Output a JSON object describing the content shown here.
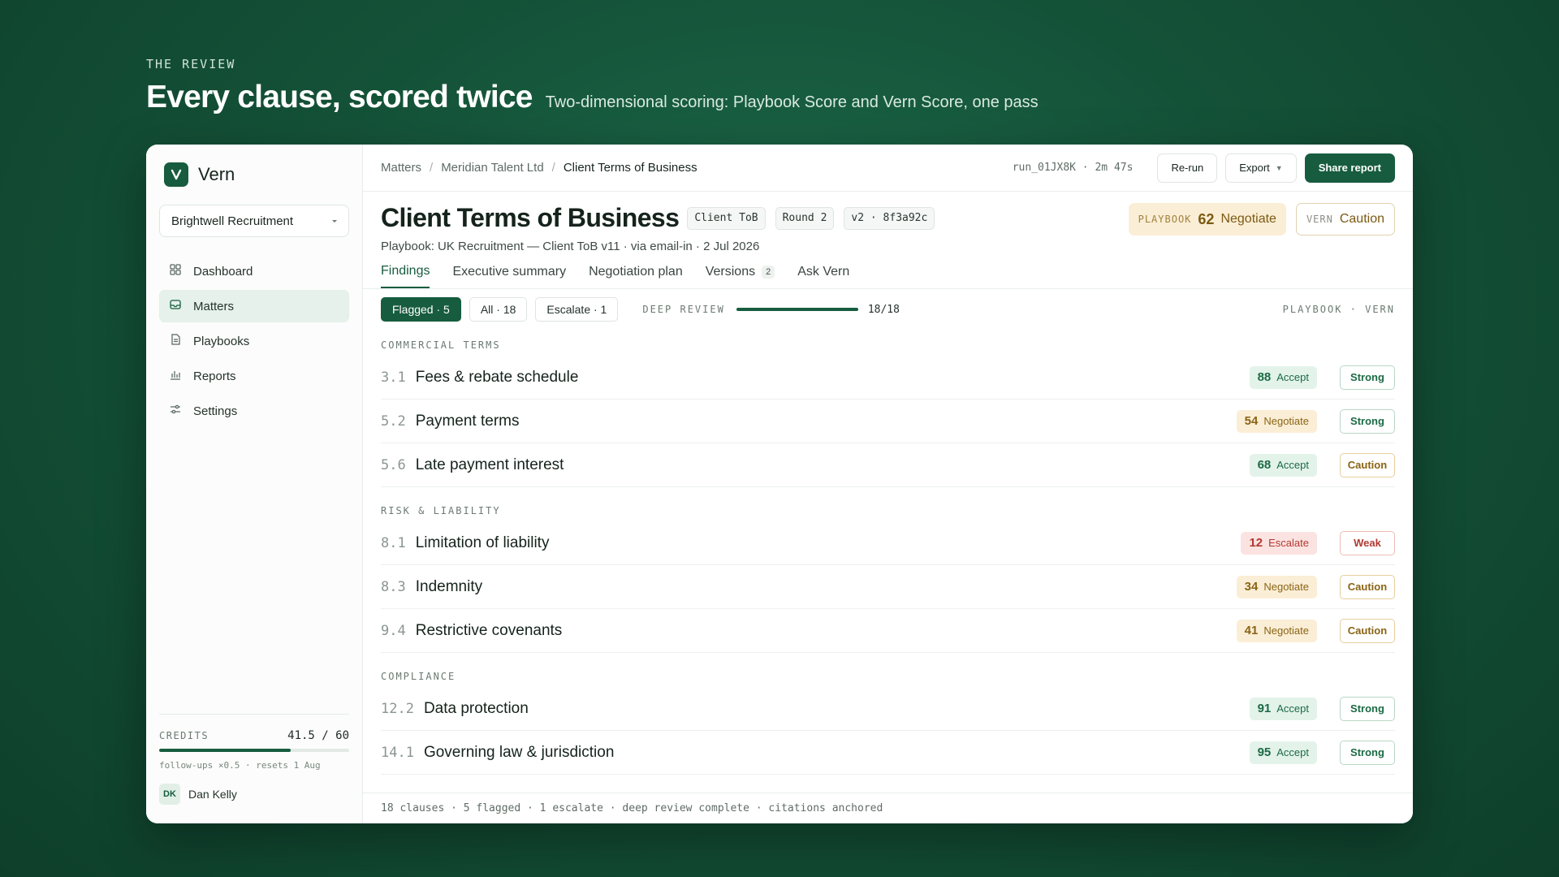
{
  "hero": {
    "eyebrow": "THE REVIEW",
    "title": "Every clause, scored twice",
    "subtitle": "Two-dimensional scoring: Playbook Score and Vern Score, one pass"
  },
  "sidebar": {
    "brand": "Vern",
    "workspace": "Brightwell Recruitment",
    "nav": [
      {
        "label": "Dashboard",
        "icon": "grid-icon"
      },
      {
        "label": "Matters",
        "icon": "inbox-icon"
      },
      {
        "label": "Playbooks",
        "icon": "document-icon"
      },
      {
        "label": "Reports",
        "icon": "bar-chart-icon"
      },
      {
        "label": "Settings",
        "icon": "sliders-icon"
      }
    ],
    "credits": {
      "label": "CREDITS",
      "value": "41.5 / 60",
      "used": 41.5,
      "total": 60,
      "note": "follow-ups ×0.5 · resets 1 Aug"
    },
    "user": {
      "initials": "DK",
      "name": "Dan Kelly"
    }
  },
  "topbar": {
    "breadcrumbs": [
      "Matters",
      "Meridian Talent Ltd",
      "Client Terms of Business"
    ],
    "run": "run_01JX8K · 2m 47s",
    "rerun_label": "Re-run",
    "export_label": "Export",
    "share_label": "Share report"
  },
  "doc": {
    "title": "Client Terms of Business",
    "tags": [
      "Client ToB",
      "Round 2",
      "v2 · 8f3a92c"
    ],
    "meta": "Playbook: UK Recruitment — Client ToB v11 · via email-in · 2 Jul 2026",
    "playbook_score": {
      "label": "PLAYBOOK",
      "value": "62",
      "verdict": "Negotiate"
    },
    "vern_score": {
      "label": "VERN",
      "verdict": "Caution"
    }
  },
  "tabs": [
    {
      "label": "Findings",
      "count": ""
    },
    {
      "label": "Executive summary",
      "count": ""
    },
    {
      "label": "Negotiation plan",
      "count": ""
    },
    {
      "label": "Versions",
      "count": "2"
    },
    {
      "label": "Ask Vern",
      "count": ""
    }
  ],
  "filters": {
    "flagged": "Flagged · 5",
    "all": "All · 18",
    "escalate": "Escalate · 1",
    "deep_review_label": "DEEP REVIEW",
    "deep_review_value": "18/18",
    "deep_review_progress": 1.0,
    "column_header": "PLAYBOOK · VERN"
  },
  "sections": [
    {
      "label": "COMMERCIAL TERMS",
      "clauses": [
        {
          "num": "3.1",
          "title": "Fees & rebate schedule",
          "score": "88",
          "verdict": "Accept",
          "vern": "Strong"
        },
        {
          "num": "5.2",
          "title": "Payment terms",
          "score": "54",
          "verdict": "Negotiate",
          "vern": "Strong"
        },
        {
          "num": "5.6",
          "title": "Late payment interest",
          "score": "68",
          "verdict": "Accept",
          "vern": "Caution"
        }
      ]
    },
    {
      "label": "RISK & LIABILITY",
      "clauses": [
        {
          "num": "8.1",
          "title": "Limitation of liability",
          "score": "12",
          "verdict": "Escalate",
          "vern": "Weak"
        },
        {
          "num": "8.3",
          "title": "Indemnity",
          "score": "34",
          "verdict": "Negotiate",
          "vern": "Caution"
        },
        {
          "num": "9.4",
          "title": "Restrictive covenants",
          "score": "41",
          "verdict": "Negotiate",
          "vern": "Caution"
        }
      ]
    },
    {
      "label": "COMPLIANCE",
      "clauses": [
        {
          "num": "12.2",
          "title": "Data protection",
          "score": "91",
          "verdict": "Accept",
          "vern": "Strong"
        },
        {
          "num": "14.1",
          "title": "Governing law & jurisdiction",
          "score": "95",
          "verdict": "Accept",
          "vern": "Strong"
        }
      ]
    }
  ],
  "footer": "18 clauses · 5 flagged · 1 escalate · deep review complete · citations anchored",
  "colors": {
    "accent": "#175c3f",
    "accept": "#1c6a45",
    "negotiate": "#8a6415",
    "escalate": "#b23a32"
  }
}
